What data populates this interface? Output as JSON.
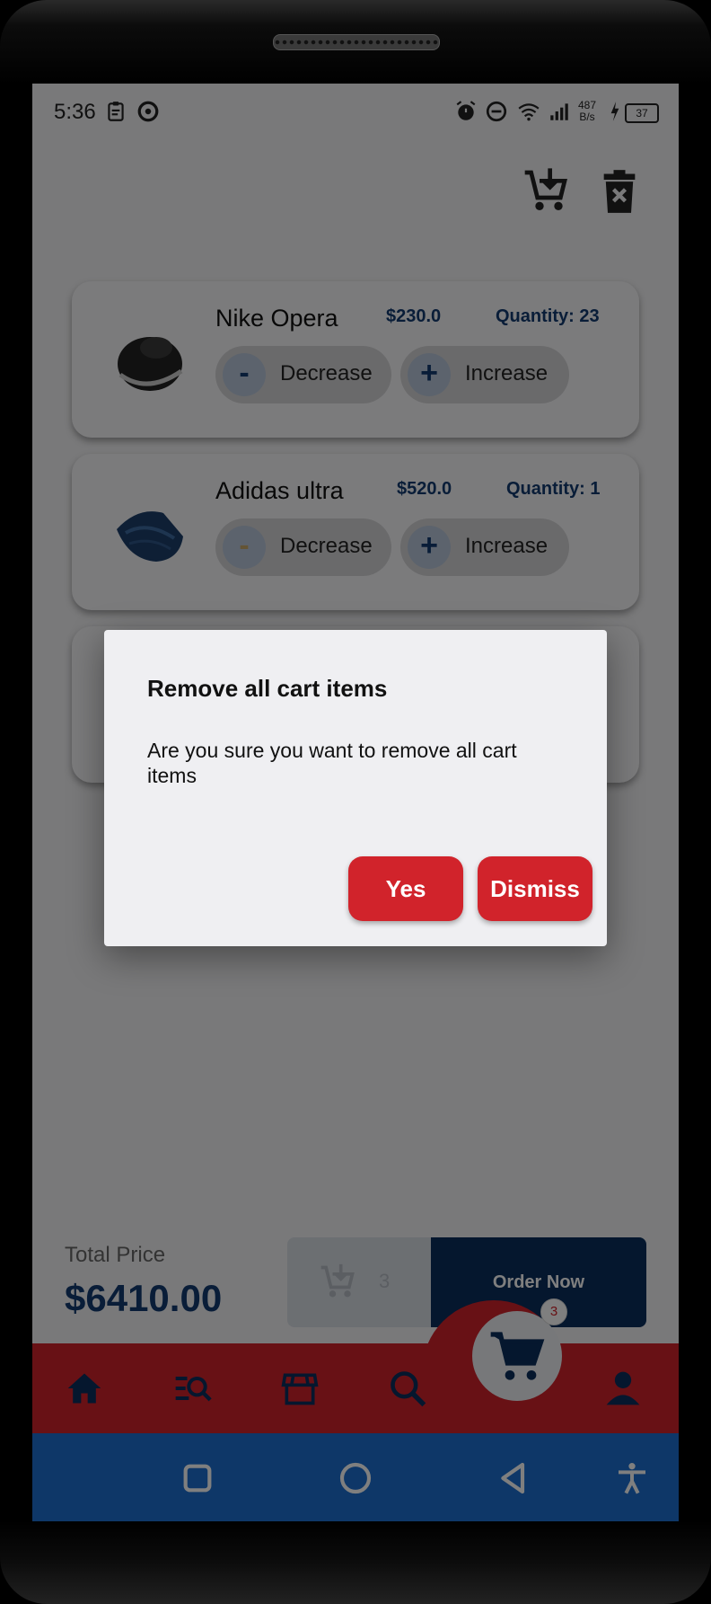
{
  "status_bar": {
    "time": "5:36",
    "net_speed_value": "487",
    "net_speed_unit": "B/s",
    "battery": "37"
  },
  "header": {
    "add_cart_icon": "cart-add-icon",
    "clear_cart_icon": "trash-x-icon"
  },
  "cart_items": [
    {
      "name": "Nike Opera",
      "price": "$230.0",
      "quantity": "Quantity: 23",
      "decrease_symbol": "-",
      "decrease_label": "Decrease",
      "increase_symbol": "+",
      "increase_label": "Increase"
    },
    {
      "name": "Adidas ultra",
      "price": "$520.0",
      "quantity": "Quantity: 1",
      "decrease_symbol": "-",
      "decrease_label": "Decrease",
      "increase_symbol": "+",
      "increase_label": "Increase"
    }
  ],
  "summary": {
    "total_label": "Total Price",
    "total_value": "$6410.00",
    "cart_count": "3",
    "order_label": "Order Now"
  },
  "bottom_nav": {
    "badge": "3",
    "items": [
      "home-icon",
      "search-list-icon",
      "store-icon",
      "search-icon",
      "cart-icon",
      "profile-icon"
    ]
  },
  "dialog": {
    "title": "Remove all cart items",
    "message": "Are you sure you want to remove all cart items",
    "yes_label": "Yes",
    "dismiss_label": "Dismiss"
  },
  "colors": {
    "primary_red": "#d1232b",
    "navy": "#0b2e5c",
    "system_nav_blue": "#1c6fd0"
  }
}
